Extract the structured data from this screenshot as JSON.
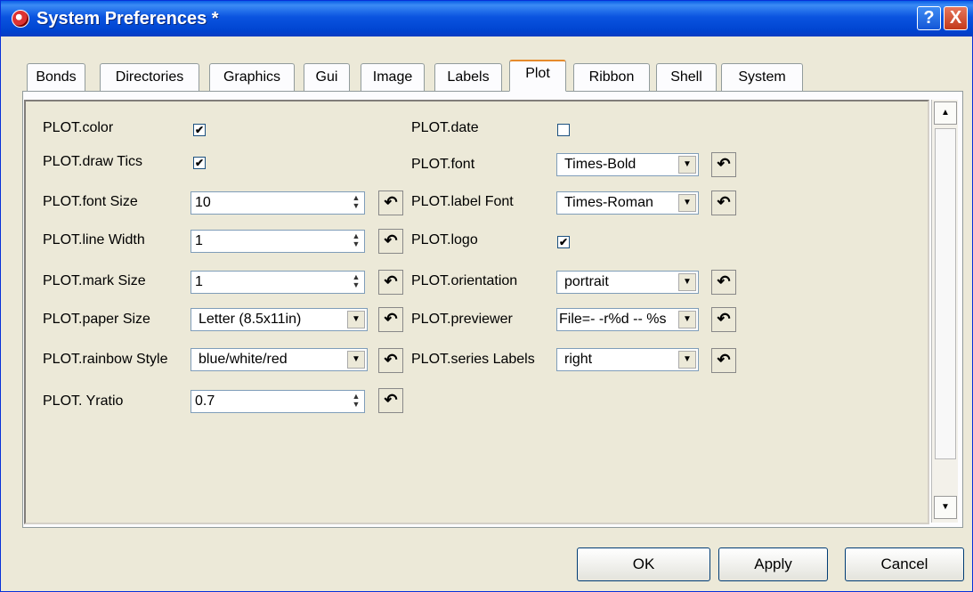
{
  "window": {
    "title": "System Preferences *"
  },
  "titlebar": {
    "help_label": "?",
    "close_label": "X"
  },
  "tabs": [
    "Bonds",
    "Directories",
    "Graphics",
    "Gui",
    "Image",
    "Labels",
    "Plot",
    "Ribbon",
    "Shell",
    "System"
  ],
  "active_tab": "Plot",
  "left": {
    "color": {
      "label": "PLOT.color",
      "checked": true
    },
    "draw_tics": {
      "label": "PLOT.draw Tics",
      "checked": true
    },
    "font_size": {
      "label": "PLOT.font Size",
      "value": "10"
    },
    "line_width": {
      "label": "PLOT.line Width",
      "value": "1"
    },
    "mark_size": {
      "label": "PLOT.mark Size",
      "value": "1"
    },
    "paper_size": {
      "label": "PLOT.paper Size",
      "value": "Letter (8.5x11in)"
    },
    "rainbow_style": {
      "label": "PLOT.rainbow Style",
      "value": "blue/white/red"
    },
    "yratio": {
      "label": "PLOT. Yratio",
      "value": "0.7"
    }
  },
  "right": {
    "date": {
      "label": "PLOT.date",
      "checked": false
    },
    "font": {
      "label": "PLOT.font",
      "value": "Times-Bold"
    },
    "label_font": {
      "label": "PLOT.label Font",
      "value": "Times-Roman"
    },
    "logo": {
      "label": "PLOT.logo",
      "checked": true
    },
    "orientation": {
      "label": "PLOT.orientation",
      "value": "portrait"
    },
    "previewer": {
      "label": "PLOT.previewer",
      "value": "File=- -r%d -- %s"
    },
    "series_labels": {
      "label": "PLOT.series Labels",
      "value": "right"
    }
  },
  "buttons": {
    "ok": "OK",
    "apply": "Apply",
    "cancel": "Cancel"
  },
  "colors": {
    "titlebar": "#0054e3",
    "accent_tab": "#e68b2c",
    "face": "#ece9d8"
  }
}
